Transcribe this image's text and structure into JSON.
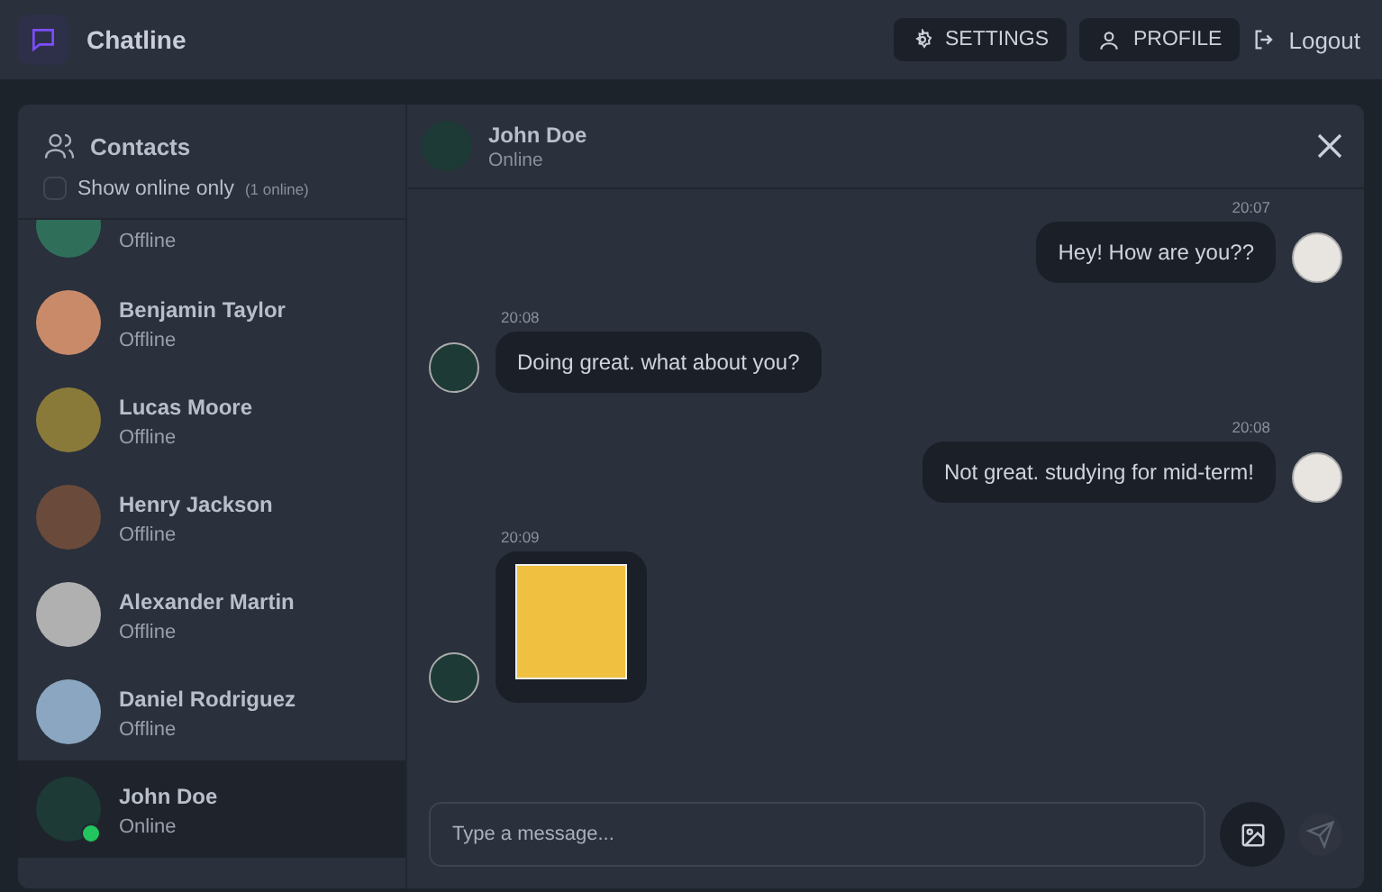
{
  "app": {
    "name": "Chatline"
  },
  "nav": [
    {
      "kind": "settings",
      "label": "SETTINGS"
    },
    {
      "kind": "profile",
      "label": "PROFILE"
    },
    {
      "kind": "logout",
      "label": "Logout"
    }
  ],
  "sidebar": {
    "title": "Contacts",
    "filter": {
      "label": "Show online only",
      "count": "(1 online)",
      "checked": false
    },
    "contacts": [
      {
        "status": "Offline",
        "online": false,
        "selected": false,
        "color": "#2f6f5a"
      },
      {
        "name": "Benjamin Taylor",
        "status": "Offline",
        "online": false,
        "selected": false,
        "color": "#c98a6a"
      },
      {
        "name": "Lucas Moore",
        "status": "Offline",
        "online": false,
        "selected": false,
        "color": "#8a7a3a"
      },
      {
        "name": "Henry Jackson",
        "status": "Offline",
        "online": false,
        "selected": false,
        "color": "#6a4a3a"
      },
      {
        "name": "Alexander Martin",
        "status": "Offline",
        "online": false,
        "selected": false,
        "color": "#b0b0b0"
      },
      {
        "name": "Daniel Rodriguez",
        "status": "Offline",
        "online": false,
        "selected": false,
        "color": "#8aa6c0"
      },
      {
        "name": "John Doe",
        "status": "Online",
        "online": true,
        "selected": true,
        "color": "#1d3a36"
      }
    ]
  },
  "chat": {
    "name": "John Doe",
    "status": "Online",
    "messages": [
      {
        "outgoing": true,
        "kind": "text",
        "time": "20:07",
        "text": "Hey! How are you??"
      },
      {
        "outgoing": false,
        "kind": "text",
        "time": "20:08",
        "text": "Doing great. what about you?"
      },
      {
        "outgoing": true,
        "kind": "text",
        "time": "20:08",
        "text": "Not great. studying for mid-term!"
      },
      {
        "outgoing": false,
        "kind": "image",
        "time": "20:09"
      }
    ],
    "input": {
      "placeholder": "Type a message..."
    }
  }
}
